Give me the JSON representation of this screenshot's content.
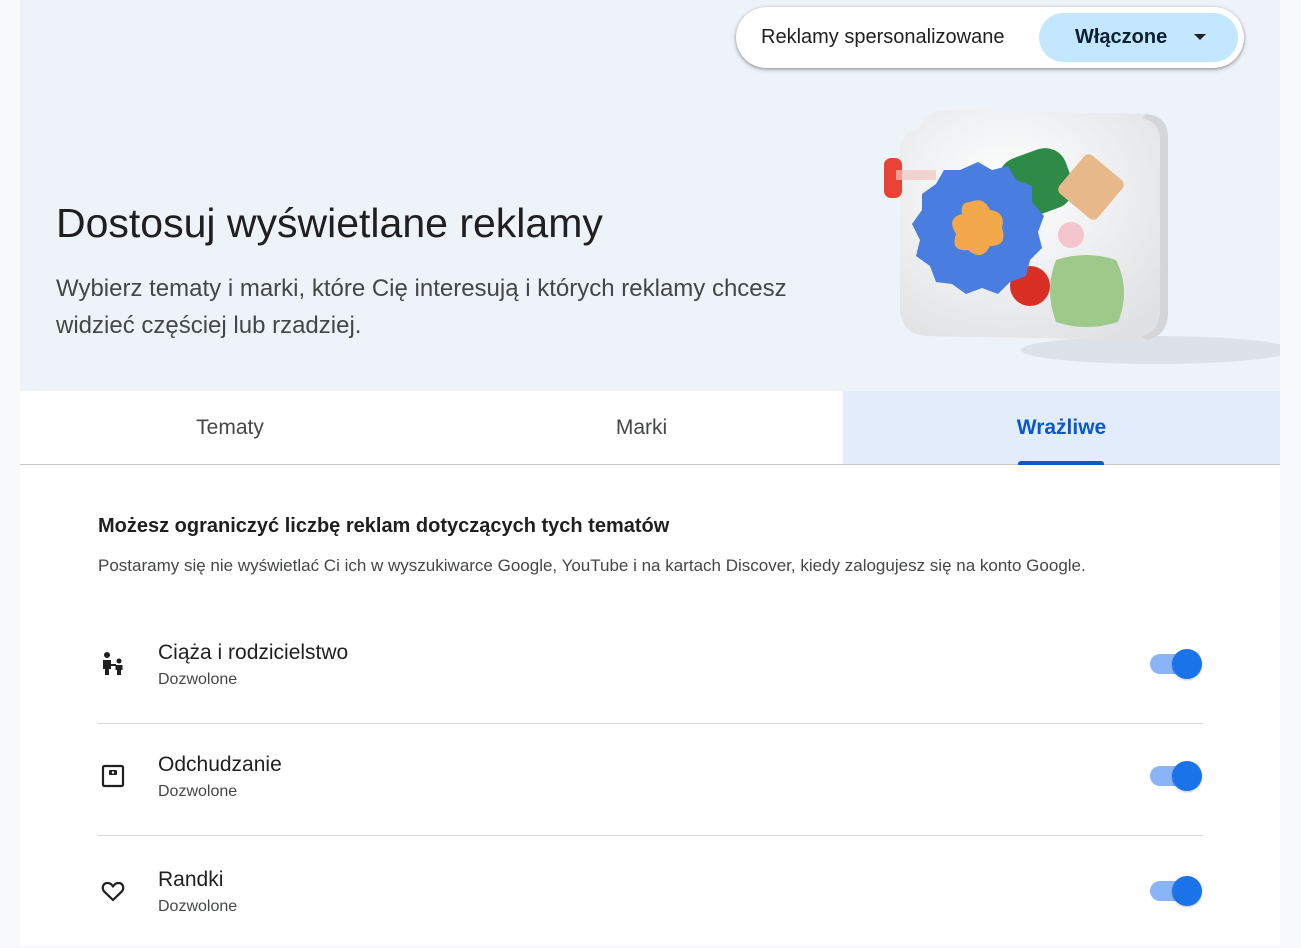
{
  "ads_setting": {
    "label": "Reklamy spersonalizowane",
    "value": "Włączone"
  },
  "hero": {
    "title": "Dostosuj wyświetlane reklamy",
    "description": "Wybierz tematy i marki, które Cię interesują i których reklamy chcesz widzieć częściej lub rzadziej."
  },
  "tabs": [
    {
      "label": "Tematy",
      "selected": false
    },
    {
      "label": "Marki",
      "selected": false
    },
    {
      "label": "Wrażliwe",
      "selected": true
    }
  ],
  "section": {
    "title": "Możesz ograniczyć liczbę reklam dotyczących tych tematów",
    "description": "Postaramy się nie wyświetlać Ci ich w wyszukiwarce Google, YouTube i na kartach Discover, kiedy zalogujesz się na konto Google."
  },
  "topics": [
    {
      "title": "Ciąża i rodzicielstwo",
      "status": "Dozwolone",
      "icon": "parent-child-icon",
      "enabled": true
    },
    {
      "title": "Odchudzanie",
      "status": "Dozwolone",
      "icon": "scale-icon",
      "enabled": true
    },
    {
      "title": "Randki",
      "status": "Dozwolone",
      "icon": "heart-icon",
      "enabled": true
    }
  ],
  "colors": {
    "accent": "#0b57d0",
    "toggle_on": "#1a73e8",
    "pill_bg": "#c2e7ff",
    "hero_bg": "#eef2f9"
  }
}
